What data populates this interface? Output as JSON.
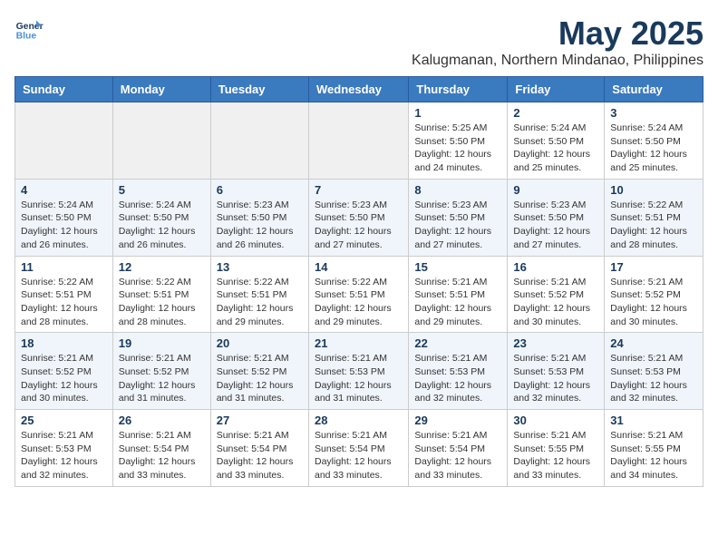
{
  "logo": {
    "line1": "General",
    "line2": "Blue"
  },
  "title": "May 2025",
  "subtitle": "Kalugmanan, Northern Mindanao, Philippines",
  "weekdays": [
    "Sunday",
    "Monday",
    "Tuesday",
    "Wednesday",
    "Thursday",
    "Friday",
    "Saturday"
  ],
  "weeks": [
    [
      {
        "day": "",
        "info": ""
      },
      {
        "day": "",
        "info": ""
      },
      {
        "day": "",
        "info": ""
      },
      {
        "day": "",
        "info": ""
      },
      {
        "day": "1",
        "info": "Sunrise: 5:25 AM\nSunset: 5:50 PM\nDaylight: 12 hours\nand 24 minutes."
      },
      {
        "day": "2",
        "info": "Sunrise: 5:24 AM\nSunset: 5:50 PM\nDaylight: 12 hours\nand 25 minutes."
      },
      {
        "day": "3",
        "info": "Sunrise: 5:24 AM\nSunset: 5:50 PM\nDaylight: 12 hours\nand 25 minutes."
      }
    ],
    [
      {
        "day": "4",
        "info": "Sunrise: 5:24 AM\nSunset: 5:50 PM\nDaylight: 12 hours\nand 26 minutes."
      },
      {
        "day": "5",
        "info": "Sunrise: 5:24 AM\nSunset: 5:50 PM\nDaylight: 12 hours\nand 26 minutes."
      },
      {
        "day": "6",
        "info": "Sunrise: 5:23 AM\nSunset: 5:50 PM\nDaylight: 12 hours\nand 26 minutes."
      },
      {
        "day": "7",
        "info": "Sunrise: 5:23 AM\nSunset: 5:50 PM\nDaylight: 12 hours\nand 27 minutes."
      },
      {
        "day": "8",
        "info": "Sunrise: 5:23 AM\nSunset: 5:50 PM\nDaylight: 12 hours\nand 27 minutes."
      },
      {
        "day": "9",
        "info": "Sunrise: 5:23 AM\nSunset: 5:50 PM\nDaylight: 12 hours\nand 27 minutes."
      },
      {
        "day": "10",
        "info": "Sunrise: 5:22 AM\nSunset: 5:51 PM\nDaylight: 12 hours\nand 28 minutes."
      }
    ],
    [
      {
        "day": "11",
        "info": "Sunrise: 5:22 AM\nSunset: 5:51 PM\nDaylight: 12 hours\nand 28 minutes."
      },
      {
        "day": "12",
        "info": "Sunrise: 5:22 AM\nSunset: 5:51 PM\nDaylight: 12 hours\nand 28 minutes."
      },
      {
        "day": "13",
        "info": "Sunrise: 5:22 AM\nSunset: 5:51 PM\nDaylight: 12 hours\nand 29 minutes."
      },
      {
        "day": "14",
        "info": "Sunrise: 5:22 AM\nSunset: 5:51 PM\nDaylight: 12 hours\nand 29 minutes."
      },
      {
        "day": "15",
        "info": "Sunrise: 5:21 AM\nSunset: 5:51 PM\nDaylight: 12 hours\nand 29 minutes."
      },
      {
        "day": "16",
        "info": "Sunrise: 5:21 AM\nSunset: 5:52 PM\nDaylight: 12 hours\nand 30 minutes."
      },
      {
        "day": "17",
        "info": "Sunrise: 5:21 AM\nSunset: 5:52 PM\nDaylight: 12 hours\nand 30 minutes."
      }
    ],
    [
      {
        "day": "18",
        "info": "Sunrise: 5:21 AM\nSunset: 5:52 PM\nDaylight: 12 hours\nand 30 minutes."
      },
      {
        "day": "19",
        "info": "Sunrise: 5:21 AM\nSunset: 5:52 PM\nDaylight: 12 hours\nand 31 minutes."
      },
      {
        "day": "20",
        "info": "Sunrise: 5:21 AM\nSunset: 5:52 PM\nDaylight: 12 hours\nand 31 minutes."
      },
      {
        "day": "21",
        "info": "Sunrise: 5:21 AM\nSunset: 5:53 PM\nDaylight: 12 hours\nand 31 minutes."
      },
      {
        "day": "22",
        "info": "Sunrise: 5:21 AM\nSunset: 5:53 PM\nDaylight: 12 hours\nand 32 minutes."
      },
      {
        "day": "23",
        "info": "Sunrise: 5:21 AM\nSunset: 5:53 PM\nDaylight: 12 hours\nand 32 minutes."
      },
      {
        "day": "24",
        "info": "Sunrise: 5:21 AM\nSunset: 5:53 PM\nDaylight: 12 hours\nand 32 minutes."
      }
    ],
    [
      {
        "day": "25",
        "info": "Sunrise: 5:21 AM\nSunset: 5:53 PM\nDaylight: 12 hours\nand 32 minutes."
      },
      {
        "day": "26",
        "info": "Sunrise: 5:21 AM\nSunset: 5:54 PM\nDaylight: 12 hours\nand 33 minutes."
      },
      {
        "day": "27",
        "info": "Sunrise: 5:21 AM\nSunset: 5:54 PM\nDaylight: 12 hours\nand 33 minutes."
      },
      {
        "day": "28",
        "info": "Sunrise: 5:21 AM\nSunset: 5:54 PM\nDaylight: 12 hours\nand 33 minutes."
      },
      {
        "day": "29",
        "info": "Sunrise: 5:21 AM\nSunset: 5:54 PM\nDaylight: 12 hours\nand 33 minutes."
      },
      {
        "day": "30",
        "info": "Sunrise: 5:21 AM\nSunset: 5:55 PM\nDaylight: 12 hours\nand 33 minutes."
      },
      {
        "day": "31",
        "info": "Sunrise: 5:21 AM\nSunset: 5:55 PM\nDaylight: 12 hours\nand 34 minutes."
      }
    ]
  ]
}
